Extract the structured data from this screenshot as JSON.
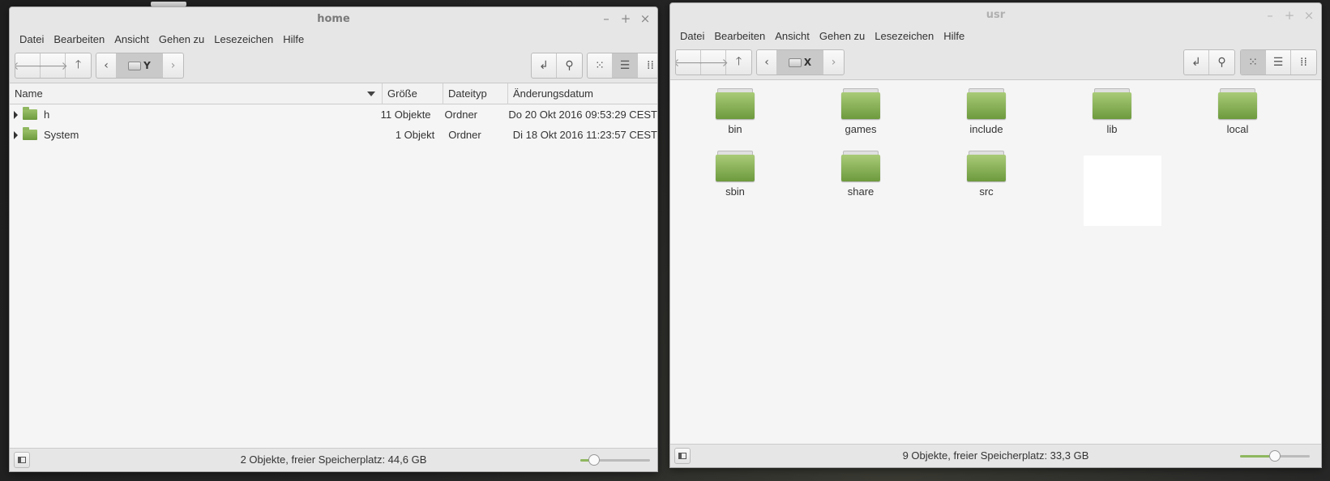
{
  "left_window": {
    "title": "home",
    "menu": [
      "Datei",
      "Bearbeiten",
      "Ansicht",
      "Gehen zu",
      "Lesezeichen",
      "Hilfe"
    ],
    "path_label": "Y",
    "columns": [
      "Name",
      "Größe",
      "Dateityp",
      "Änderungsdatum"
    ],
    "rows": [
      {
        "name": "h",
        "size": "11 Objekte",
        "type": "Ordner",
        "date": "Do 20 Okt 2016 09:53:29 CEST"
      },
      {
        "name": "System",
        "size": "1 Objekt",
        "type": "Ordner",
        "date": "Di 18 Okt 2016 11:23:57 CEST"
      }
    ],
    "status": "2 Objekte, freier Speicherplatz: 44,6 GB",
    "zoom_fraction": 0.2
  },
  "right_window": {
    "title": "usr",
    "menu": [
      "Datei",
      "Bearbeiten",
      "Ansicht",
      "Gehen zu",
      "Lesezeichen",
      "Hilfe"
    ],
    "path_label": "X",
    "folders": [
      "bin",
      "games",
      "include",
      "lib",
      "local",
      "sbin",
      "share",
      "src"
    ],
    "status": "9 Objekte, freier Speicherplatz: 33,3 GB",
    "zoom_fraction": 0.5
  },
  "wm_buttons": [
    "–",
    "+",
    "×"
  ],
  "icons": {
    "back": "arrow-left-icon",
    "forward": "arrow-right-icon",
    "up": "arrow-up-icon",
    "prev": "chevron-left-icon",
    "next": "chevron-right-icon",
    "location": "toggle-location-icon",
    "search": "search-icon",
    "icon_view": "icon-view-icon",
    "list_view": "list-view-icon",
    "compact_view": "compact-view-icon",
    "sidebar": "sidebar-toggle-icon"
  },
  "colors": {
    "folder_green": "#8fb75f",
    "chrome": "#e6e6e6",
    "content": "#f5f5f5"
  }
}
